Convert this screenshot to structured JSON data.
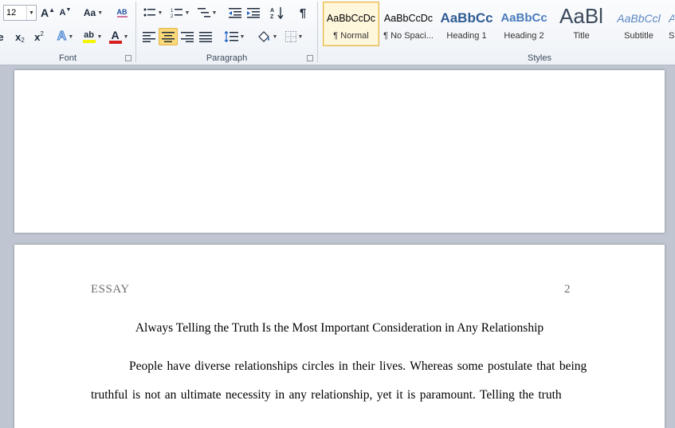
{
  "font_group": {
    "label": "Font",
    "font_size": "12",
    "grow_font": "A",
    "shrink_font": "A",
    "change_case": "Aa",
    "clear_formatting": "AB",
    "subscript": "x",
    "superscript": "x",
    "text_effects": "A",
    "highlight": "ab",
    "font_color": "A",
    "colors": {
      "highlight": "#f5f500",
      "font_color": "#d62020"
    }
  },
  "paragraph_group": {
    "label": "Paragraph",
    "show_marks": "¶"
  },
  "styles_group": {
    "label": "Styles",
    "items": [
      {
        "sample": "AaBbCcDc",
        "name": "¶ Normal",
        "selected": true
      },
      {
        "sample": "AaBbCcDc",
        "name": "¶ No Spaci..."
      },
      {
        "sample": "AaBbCc",
        "name": "Heading 1"
      },
      {
        "sample": "AaBbCc",
        "name": "Heading 2"
      },
      {
        "sample": "AaBl",
        "name": "Title"
      },
      {
        "sample": "AaBbCcl",
        "name": "Subtitle"
      },
      {
        "sample": "A",
        "name": "S"
      }
    ]
  },
  "document": {
    "header_label": "ESSAY",
    "page_number": "2",
    "title": "Always Telling the Truth Is the Most Important Consideration in Any Relationship",
    "line1": "People have diverse relationships circles in their lives. Whereas some postulate that being",
    "line2": "truthful is not an ultimate necessity in any relationship, yet it is paramount. Telling the truth"
  }
}
